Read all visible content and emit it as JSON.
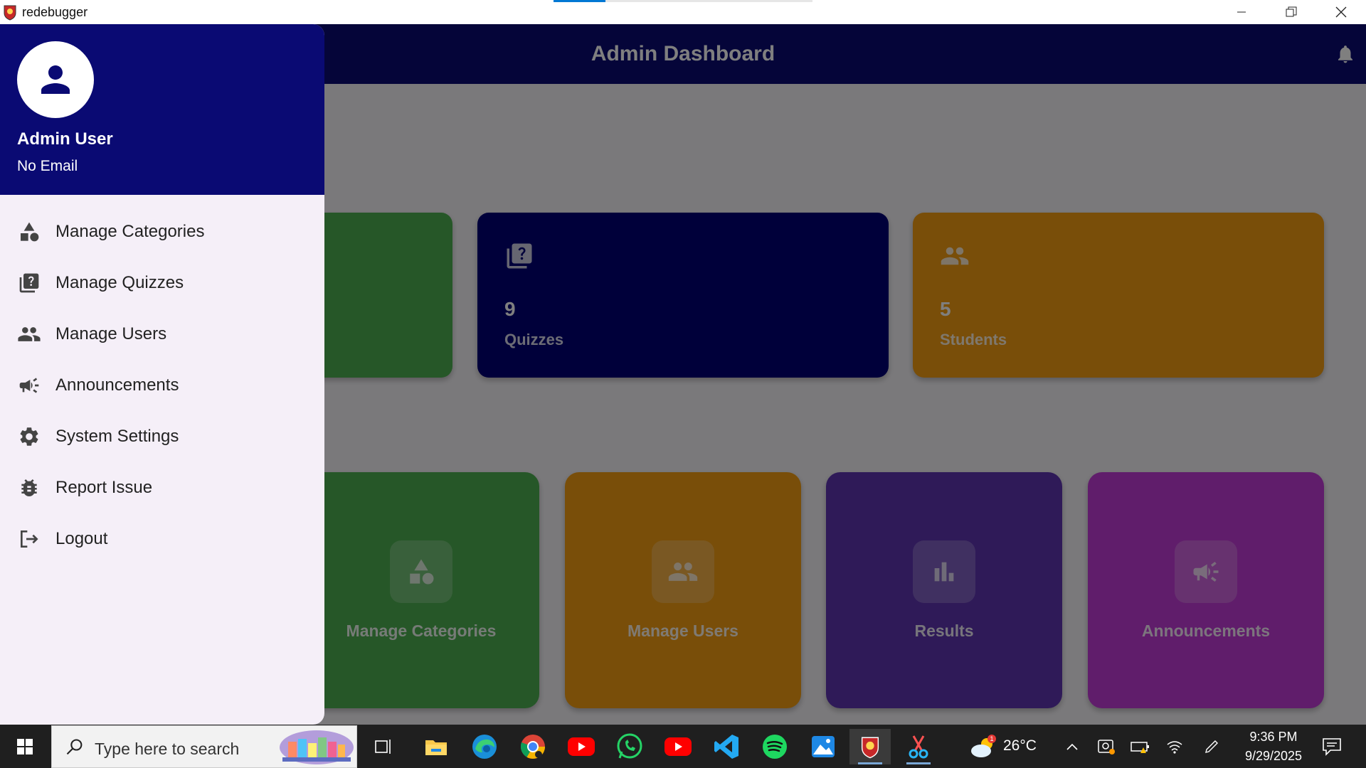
{
  "window": {
    "title": "redebugger",
    "progress": 0.2
  },
  "appbar": {
    "title": "Admin Dashboard"
  },
  "stats": [
    {
      "icon": "category-icon",
      "value": "",
      "label": "",
      "color": "#4caf50"
    },
    {
      "icon": "quiz-icon",
      "value": "9",
      "label": "Quizzes",
      "color": "#000075"
    },
    {
      "icon": "users-icon",
      "value": "5",
      "label": "Students",
      "color": "#f39c12"
    }
  ],
  "actions": [
    {
      "icon": "category-icon",
      "label": "Manage Categories",
      "color": "#4caf50"
    },
    {
      "icon": "users-icon",
      "label": "Manage Users",
      "color": "#f39c12"
    },
    {
      "icon": "bar-chart-icon",
      "label": "Results",
      "color": "#5e35b1"
    },
    {
      "icon": "megaphone-icon",
      "label": "Announcements",
      "color": "#c13ad6"
    }
  ],
  "drawer": {
    "user_name": "Admin User",
    "user_email": "No Email",
    "items": [
      {
        "label": "Manage Categories",
        "icon": "category-icon"
      },
      {
        "label": "Manage Quizzes",
        "icon": "quiz-icon"
      },
      {
        "label": "Manage Users",
        "icon": "users-icon"
      },
      {
        "label": "Announcements",
        "icon": "megaphone-icon"
      },
      {
        "label": "System Settings",
        "icon": "gear-icon"
      },
      {
        "label": "Report Issue",
        "icon": "bug-icon"
      },
      {
        "label": "Logout",
        "icon": "logout-icon"
      }
    ]
  },
  "taskbar": {
    "search_placeholder": "Type here to search",
    "temperature": "26°C",
    "weather_badge": "1",
    "time": "9:36 PM",
    "date": "9/29/2025"
  },
  "colors": {
    "primary": "#0a0a73",
    "drawer_bg": "#f5eff8",
    "taskbar": "#1f1f1f"
  }
}
